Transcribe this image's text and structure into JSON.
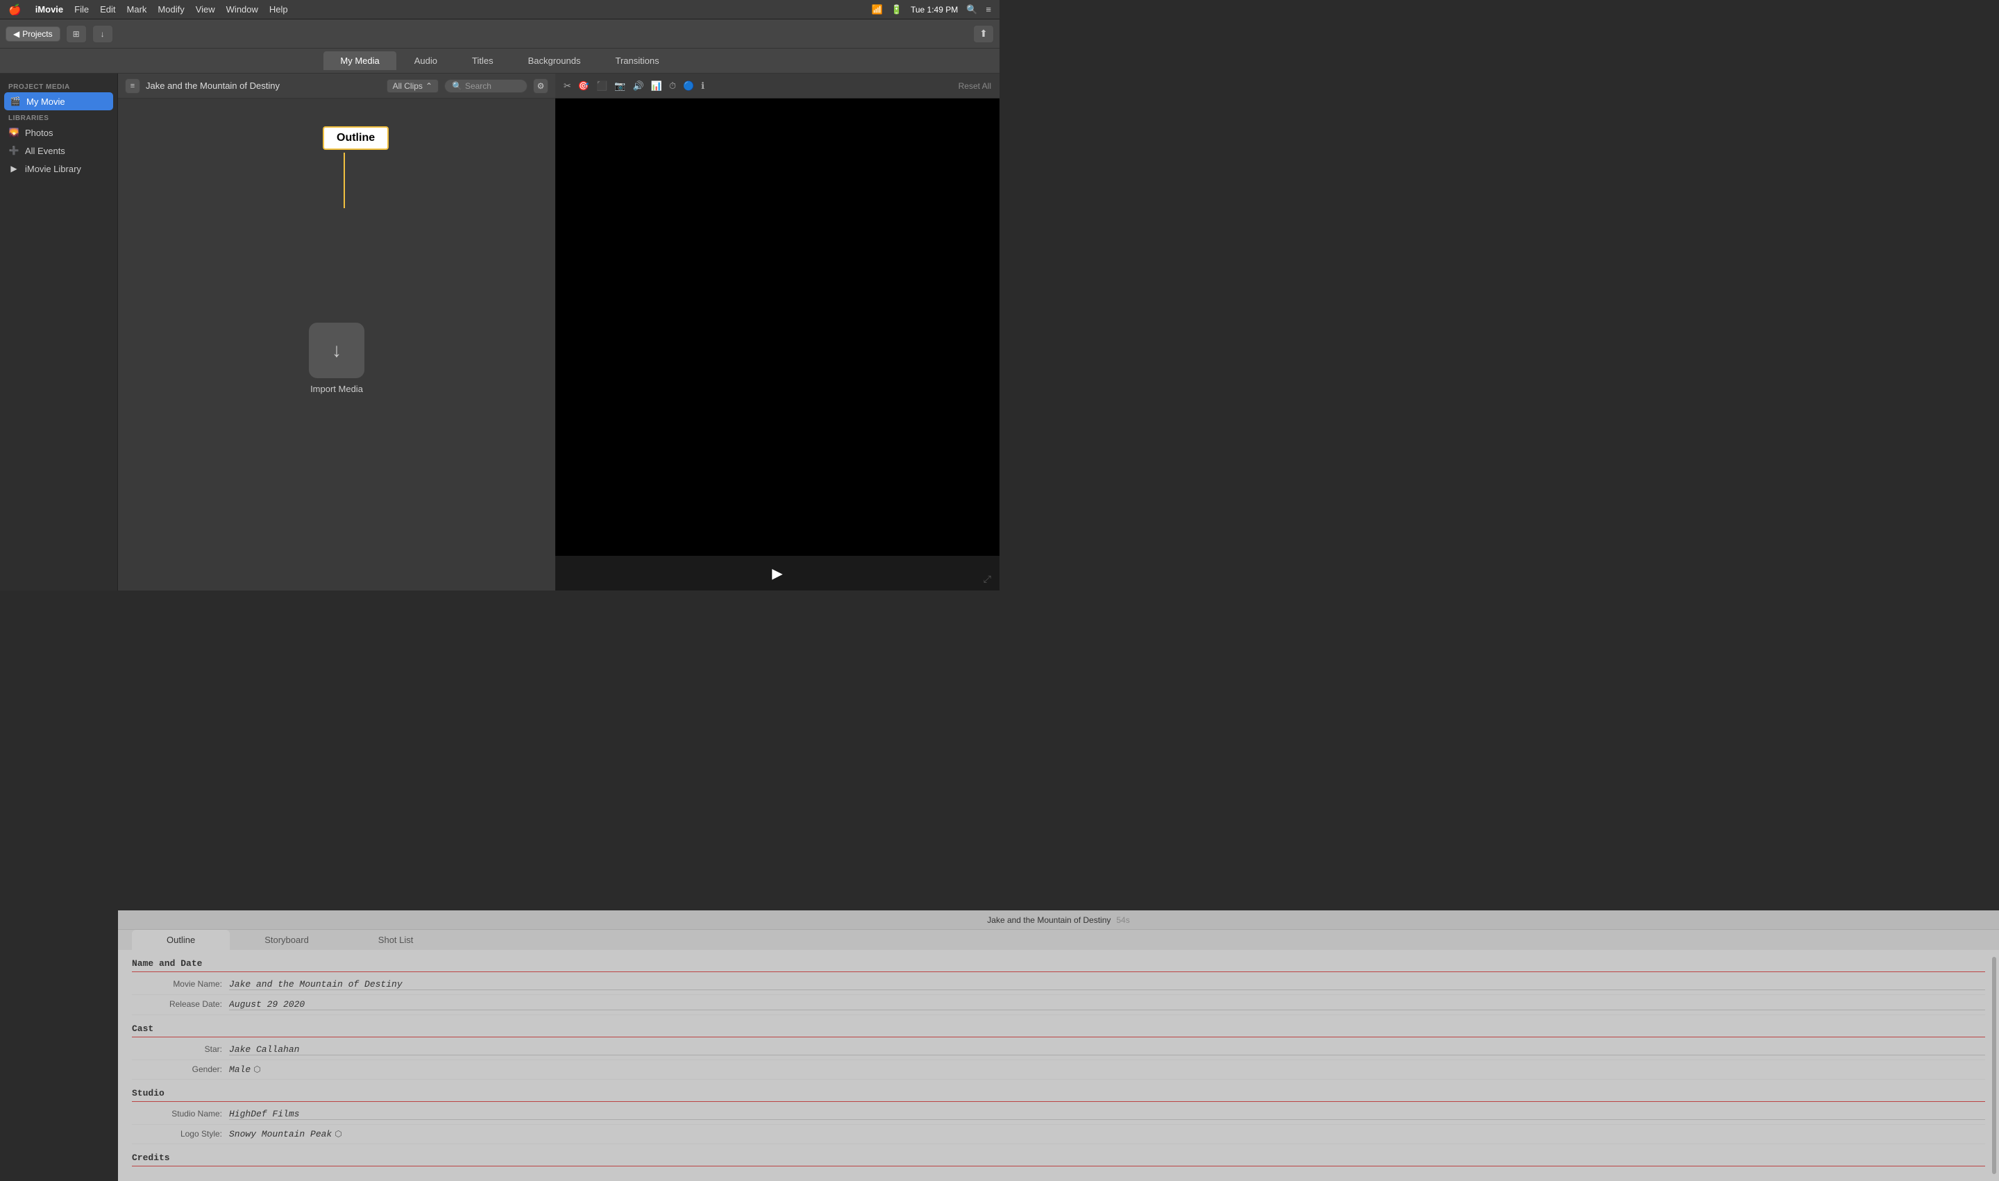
{
  "menubar": {
    "apple": "🍎",
    "app": "iMovie",
    "items": [
      "File",
      "Edit",
      "Mark",
      "Modify",
      "View",
      "Window",
      "Help"
    ],
    "time": "Tue 1:49 PM"
  },
  "toolbar": {
    "projects_label": "◀ Projects",
    "import_label": "Import Media",
    "outline_label": "Outline",
    "reset_all": "Reset All"
  },
  "tabs": {
    "items": [
      "My Media",
      "Audio",
      "Titles",
      "Backgrounds",
      "Transitions"
    ]
  },
  "sidebar": {
    "project_media_label": "PROJECT MEDIA",
    "my_movie_label": "My Movie",
    "libraries_label": "LIBRARIES",
    "photos_label": "Photos",
    "all_events_label": "All Events",
    "imovie_library_label": "iMovie Library"
  },
  "browser": {
    "project_title": "Jake and the Mountain of Destiny",
    "all_clips": "All Clips",
    "search_placeholder": "Search",
    "import_media": "Import Media"
  },
  "preview": {
    "tools": [
      "crop",
      "stabilize",
      "trim",
      "volume",
      "bar_chart",
      "speed",
      "filter",
      "info"
    ],
    "reset_all": "Reset All"
  },
  "timeline": {
    "title": "Jake and the Mountain of Destiny",
    "duration": "54s",
    "tabs": [
      "Outline",
      "Storyboard",
      "Shot List"
    ]
  },
  "outline": {
    "sections": [
      {
        "name": "Name and Date",
        "fields": [
          {
            "label": "Movie Name:",
            "value": "Jake and the Mountain of Destiny",
            "type": "text"
          },
          {
            "label": "Release Date:",
            "value": "August 29 2020",
            "type": "text"
          }
        ]
      },
      {
        "name": "Cast",
        "fields": [
          {
            "label": "Star:",
            "value": "Jake Callahan",
            "type": "text"
          },
          {
            "label": "Gender:",
            "value": "Male",
            "type": "stepper"
          }
        ]
      },
      {
        "name": "Studio",
        "fields": [
          {
            "label": "Studio Name:",
            "value": "HighDef Films",
            "type": "text"
          },
          {
            "label": "Logo Style:",
            "value": "Snowy Mountain Peak",
            "type": "stepper"
          }
        ]
      },
      {
        "name": "Credits",
        "fields": []
      }
    ]
  }
}
